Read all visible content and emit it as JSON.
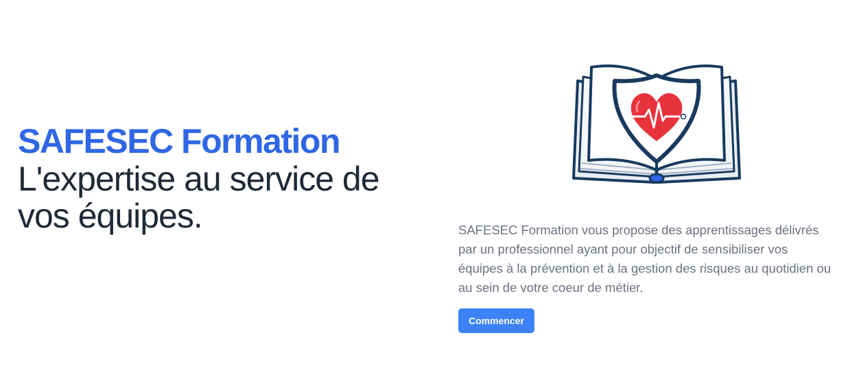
{
  "hero": {
    "title": "SAFESEC Formation",
    "tagline": "L'expertise au service de vos équipes."
  },
  "content": {
    "description": "SAFESEC Formation vous propose des apprentissages délivrés par un professionnel ayant pour objectif de sensibiliser vos équipes à la prévention et à la gestion des risques au quotidien ou au sein de votre coeur de métier.",
    "button_label": "Commencer"
  },
  "colors": {
    "brand": "#2f67e4",
    "button": "#3b82f6",
    "heart": "#e8323c",
    "book_outline": "#173a5e"
  },
  "illustration": {
    "icon": "book-shield-heart-icon"
  }
}
